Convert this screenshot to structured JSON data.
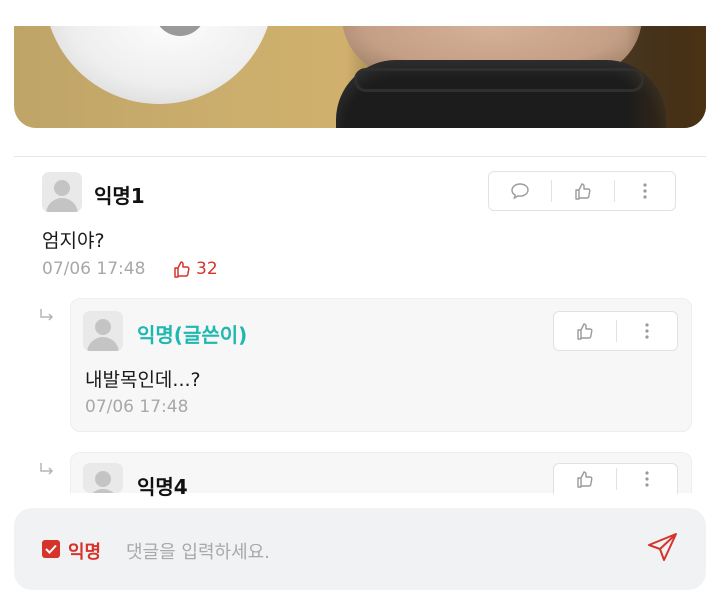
{
  "post": {
    "image": "post-photo"
  },
  "comments": [
    {
      "author": "익명1",
      "content": "엄지야?",
      "time": "07/06 17:48",
      "likes": "32"
    }
  ],
  "replies": [
    {
      "author": "익명(글쓴이)",
      "content": "내발목인데...?",
      "time": "07/06 17:48"
    },
    {
      "author": "익명4"
    }
  ],
  "input": {
    "anonymous_label": "익명",
    "anonymous_checked": true,
    "placeholder": "댓글을 입력하세요."
  },
  "colors": {
    "accent": "#d6342b",
    "author": "#1fb8b0",
    "meta": "#a8a8a8"
  },
  "icons": [
    "comment-icon",
    "thumbs-up-icon",
    "more-vertical-icon",
    "reply-arrow-icon",
    "send-icon",
    "check-icon"
  ]
}
